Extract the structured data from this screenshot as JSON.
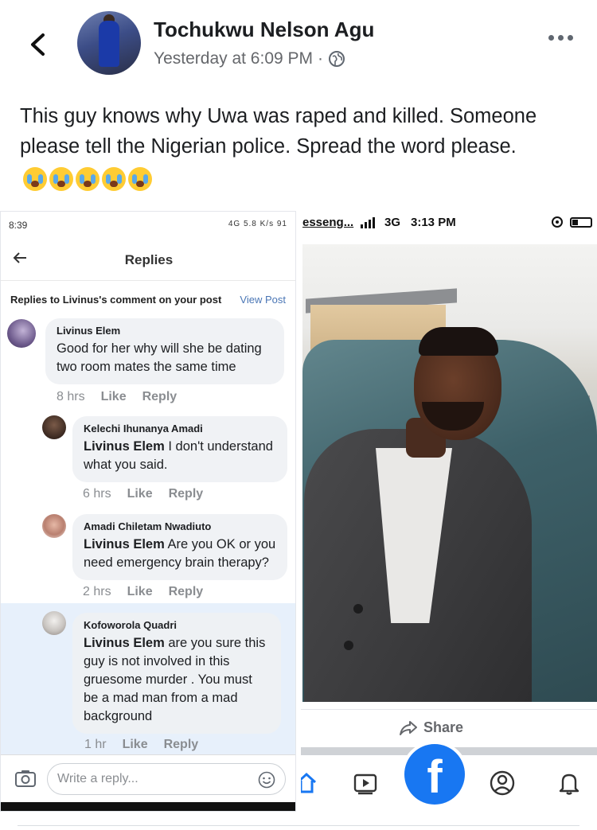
{
  "post": {
    "author": "Tochukwu Nelson Agu",
    "time": "Yesterday at 6:09 PM",
    "separator": "·",
    "privacy_icon": "globe-icon",
    "text": "This guy knows why Uwa was raped and killed. Someone please tell the Nigerian police. Spread the word please.",
    "emoji": "crying-face-emoji",
    "emoji_count": 5
  },
  "left_screenshot": {
    "status": {
      "time": "8:39",
      "right": "4G 5.8 K/s 91"
    },
    "nav_title": "Replies",
    "subheader": {
      "label": "Replies to Livinus's comment on your post",
      "link": "View Post"
    },
    "comments": [
      {
        "name": "Livinus Elem",
        "mention": "",
        "text": "Good for her why will she be dating two room mates the same time",
        "time": "8 hrs",
        "like": "Like",
        "reply": "Reply"
      },
      {
        "name": "Kelechi Ihunanya Amadi",
        "mention": "Livinus Elem",
        "text": " I don't understand what you said.",
        "time": "6 hrs",
        "like": "Like",
        "reply": "Reply"
      },
      {
        "name": "Amadi Chiletam Nwadiuto",
        "mention": "Livinus Elem",
        "text": " Are you OK or you need emergency brain therapy?",
        "time": "2 hrs",
        "like": "Like",
        "reply": "Reply"
      },
      {
        "name": "Kofoworola Quadri",
        "mention": "Livinus Elem",
        "text": " are you sure this guy is not involved in this gruesome murder . You must be a mad man from a mad background",
        "time": "1 hr",
        "like": "Like",
        "reply": "Reply"
      }
    ],
    "composer_placeholder": "Write a reply..."
  },
  "right_screenshot": {
    "status": {
      "app": "esseng...",
      "network": "3G",
      "time": "3:13 PM"
    },
    "share_label": "Share",
    "brand": "f"
  },
  "colors": {
    "brand": "#1877f2",
    "highlight": "#e7f0fb",
    "muted": "#65676b"
  }
}
